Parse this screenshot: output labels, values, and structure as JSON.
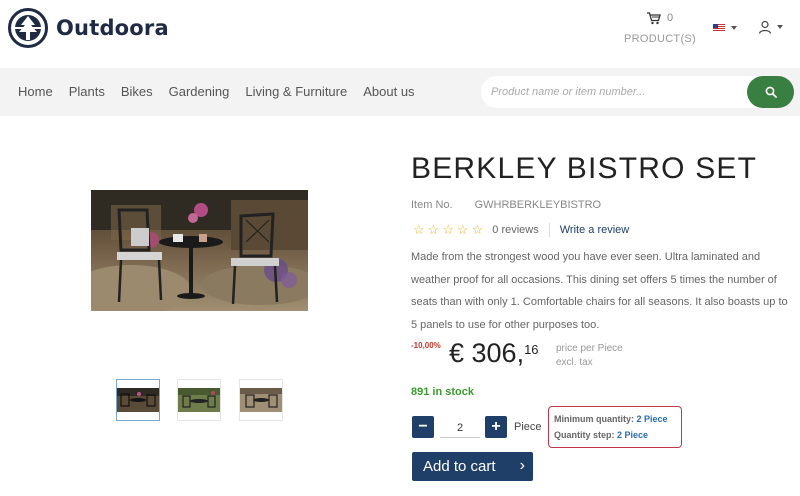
{
  "header": {
    "brand": "Outdoora",
    "cart_count": "0",
    "cart_label": "PRODUCT(S)",
    "icons": {
      "logo": "tree-circle-logo",
      "cart": "cart-icon",
      "flag": "us-flag-icon",
      "user": "user-icon"
    }
  },
  "nav": {
    "items": [
      "Home",
      "Plants",
      "Bikes",
      "Gardening",
      "Living & Furniture",
      "About us"
    ],
    "search_placeholder": "Product name or item number...",
    "search_icon": "search-icon",
    "accent": "#3a7f42"
  },
  "product": {
    "title": "BERKLEY BISTRO SET",
    "item_no_label": "Item No.",
    "item_no": "GWHRBERKLEYBISTRO",
    "rating": 0,
    "reviews": "0 reviews",
    "write_review": "Write a review",
    "description": "Made from the strongest wood you have ever seen. Ultra laminated and weather proof for all occasions. This dining set offers 5 times the number of seats than with only 1. Comfortable chairs for all seasons. It also boasts up to 5 panels to use for other purposes too.",
    "discount": "-10,00%",
    "price_main": "€ 306,",
    "price_cents": "16",
    "price_per": "price per Piece",
    "price_tax": "excl. tax",
    "stock": "891 in stock",
    "qty": "2",
    "unit": "Piece",
    "min_qty_label": "Minimum quantity:",
    "min_qty_value": "2 Piece",
    "qty_step_label": "Quantity step:",
    "qty_step_value": "2 Piece",
    "add_to_cart": "Add to cart",
    "minus": "−",
    "plus": "+",
    "arrow": "›",
    "thumbnails": 3,
    "colors": {
      "primary": "#1f3f68",
      "stock": "#3a9c2e",
      "star": "#e6b422",
      "discount": "#c0392b"
    }
  }
}
